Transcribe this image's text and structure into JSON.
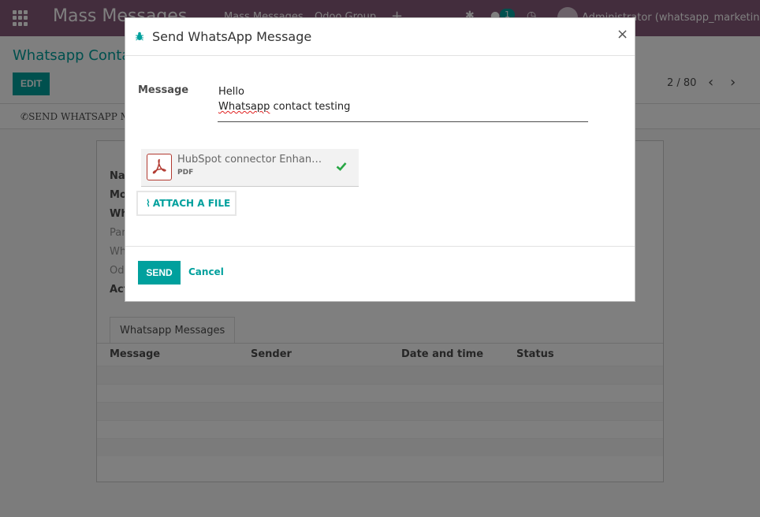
{
  "navbar": {
    "app_title": "Mass Messages",
    "menu_items": [
      "Mass Messages",
      "Odoo Group"
    ],
    "chat_count": "1",
    "user": "Administrator (whatsapp_marketing)"
  },
  "control_panel": {
    "breadcrumb": "Whatsapp Contacts",
    "edit_label": "EDIT",
    "pager": "2 / 80"
  },
  "statusbar": {
    "send_whatsapp_label": "SEND WHATSAPP MESSAGE"
  },
  "sheet": {
    "field_labels": [
      "Name",
      "Mobile",
      "Whatsapp",
      "Partner",
      "Whatsapp",
      "Odoo",
      "Active"
    ],
    "tab_label": "Whatsapp Messages",
    "columns": [
      "Message",
      "Sender",
      "Date and time",
      "Status"
    ]
  },
  "modal": {
    "title": "Send WhatsApp Message",
    "close_symbol": "×",
    "message_label": "Message",
    "message_line1": "Hello",
    "message_line2_word1": "Whatsapp",
    "message_line2_rest": " contact testing",
    "attachment": {
      "name": "HubSpot connector Enhanced ...",
      "ext": "PDF"
    },
    "attach_label": "ATTACH A FILE",
    "send_label": "SEND",
    "cancel_label": "Cancel"
  },
  "colors": {
    "brand": "#875a7b",
    "accent": "#00a09d",
    "pdf": "#b23a31",
    "success": "#28a745"
  }
}
